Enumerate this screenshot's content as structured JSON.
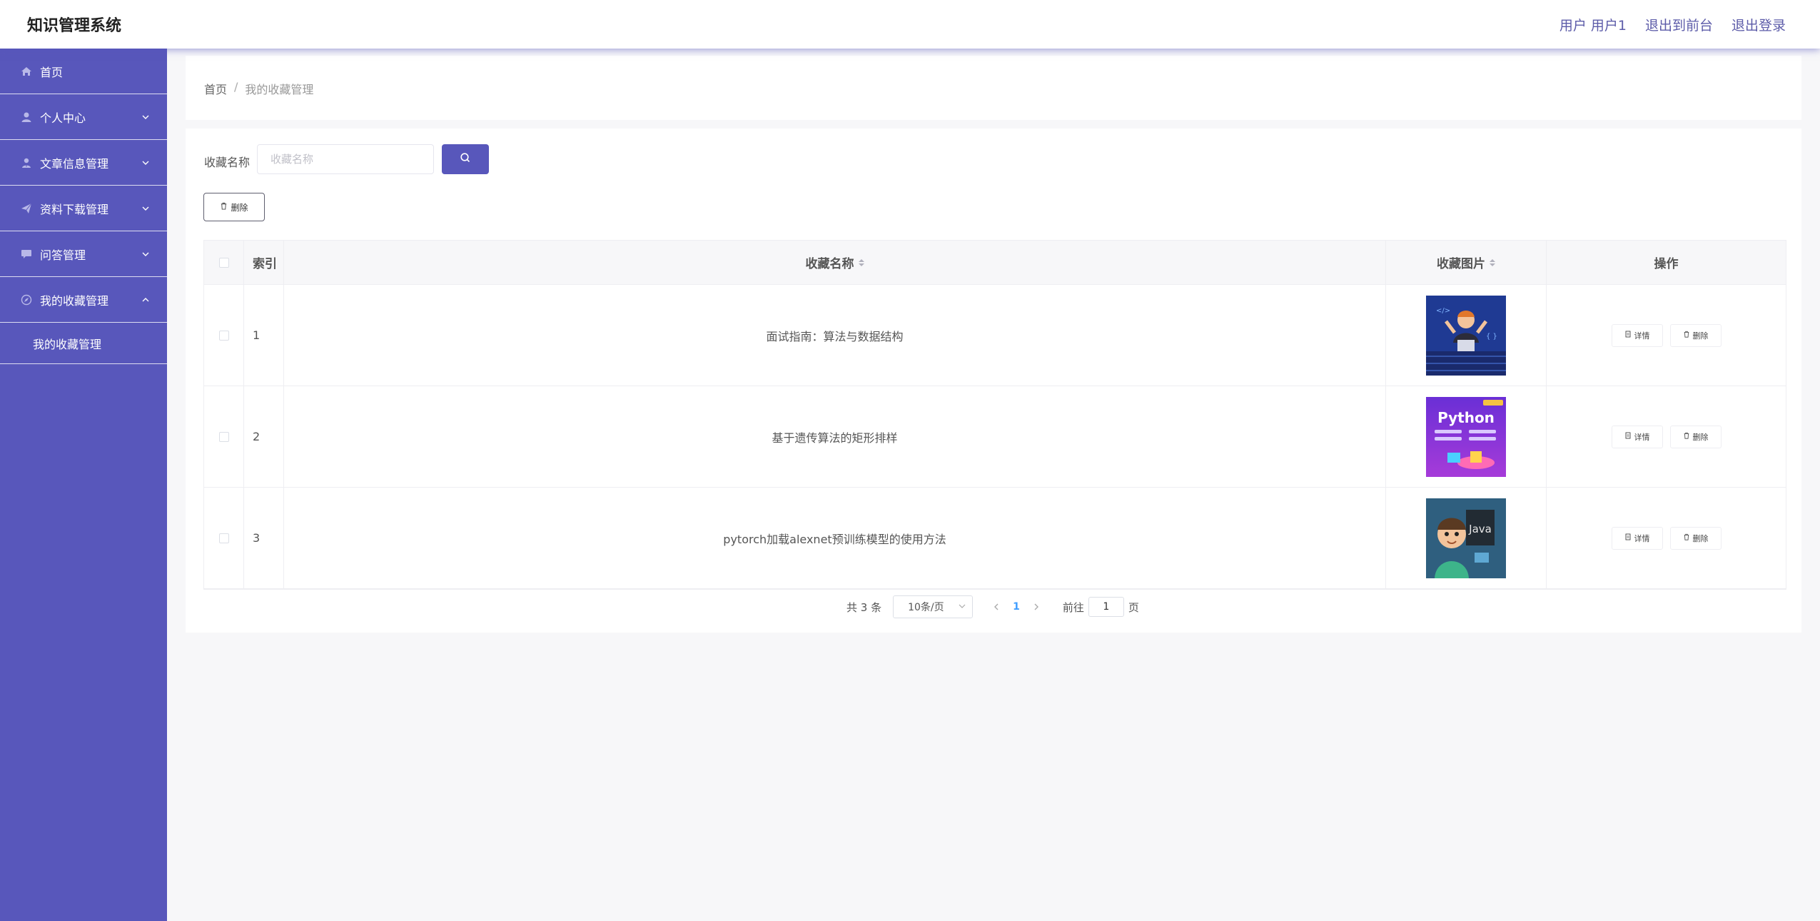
{
  "header": {
    "app_title": "知识管理系统",
    "user_label": "用户 用户1",
    "to_frontend": "退出到前台",
    "logout": "退出登录"
  },
  "sidebar": {
    "items": [
      {
        "label": "首页",
        "icon": "home-icon",
        "expandable": false
      },
      {
        "label": "个人中心",
        "icon": "user-icon",
        "expandable": true
      },
      {
        "label": "文章信息管理",
        "icon": "user-tie-icon",
        "expandable": true
      },
      {
        "label": "资料下载管理",
        "icon": "paper-plane-icon",
        "expandable": true
      },
      {
        "label": "问答管理",
        "icon": "chat-icon",
        "expandable": true
      },
      {
        "label": "我的收藏管理",
        "icon": "compass-icon",
        "expandable": true,
        "expanded": true
      }
    ],
    "submenu": {
      "label": "我的收藏管理"
    }
  },
  "breadcrumb": {
    "home": "首页",
    "separator": "/",
    "current": "我的收藏管理"
  },
  "search": {
    "label": "收藏名称",
    "placeholder": "收藏名称",
    "value": ""
  },
  "toolbar": {
    "delete_label": "删除"
  },
  "table": {
    "headers": {
      "index": "索引",
      "name": "收藏名称",
      "image": "收藏图片",
      "actions": "操作"
    },
    "rows": [
      {
        "index": "1",
        "name": "面试指南：算法与数据结构",
        "image": "cartoon-programmer-thumbnail"
      },
      {
        "index": "2",
        "name": "基于遗传算法的矩形排样",
        "image": "python-course-thumbnail"
      },
      {
        "index": "3",
        "name": "pytorch加载alexnet预训练模型的使用方法",
        "image": "java-cartoon-thumbnail"
      }
    ],
    "detail_label": "详情",
    "delete_label": "删除"
  },
  "pagination": {
    "total": "共 3 条",
    "page_size": "10条/页",
    "current_page": "1",
    "goto_label": "前往",
    "goto_value": "1",
    "page_suffix": "页"
  },
  "colors": {
    "accent": "#5857bb",
    "page_bg": "#f7f7f9",
    "link": "#409eff"
  }
}
